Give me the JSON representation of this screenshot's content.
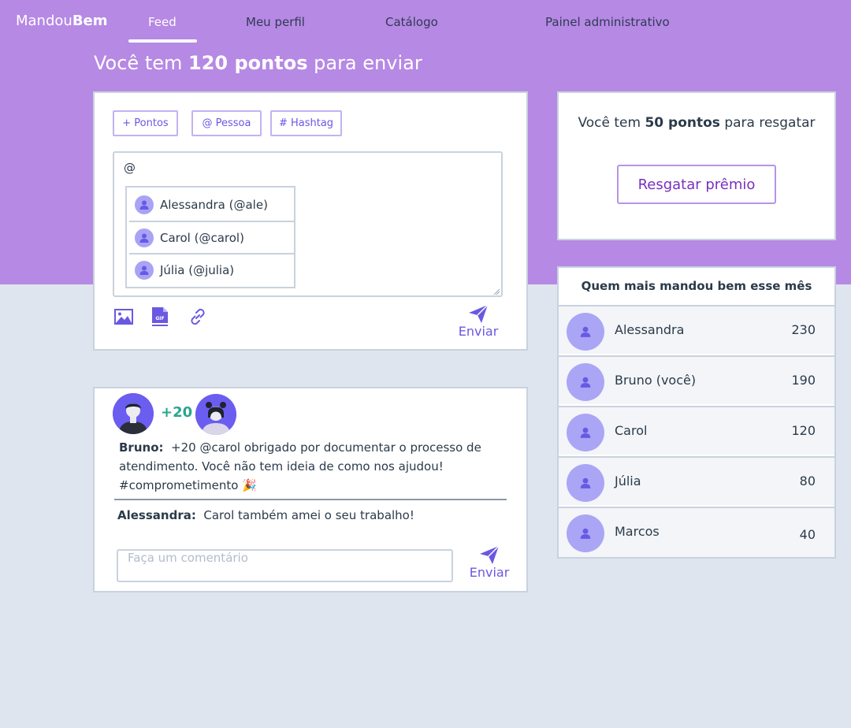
{
  "nav": {
    "logo_regular": "Mandou",
    "logo_bold": "Bem",
    "tabs": [
      {
        "label": "Feed",
        "active": true
      },
      {
        "label": "Meu perfil",
        "active": false
      },
      {
        "label": "Catálogo",
        "active": false
      },
      {
        "label": "Painel administrativo",
        "active": false
      }
    ]
  },
  "header": {
    "prefix": "Você tem",
    "points": "120 pontos",
    "suffix": "para enviar"
  },
  "compose": {
    "chips": [
      "+ Pontos",
      "@ Pessoa",
      "# Hashtag"
    ],
    "text": "@",
    "mentions": [
      "Alessandra (@ale)",
      "Carol (@carol)",
      "Júlia (@julia)"
    ],
    "tools": [
      "image-icon",
      "gif-file-icon",
      "link-icon"
    ],
    "send_label": "Enviar"
  },
  "redeem": {
    "prefix": "Você tem",
    "points": "50 pontos",
    "suffix": "para resgatar",
    "button": "Resgatar prêmio"
  },
  "ranking": {
    "title": "Quem mais mandou bem esse mês",
    "rows": [
      {
        "name": "Alessandra",
        "points": "230"
      },
      {
        "name": "Bruno (você)",
        "points": "190"
      },
      {
        "name": "Carol",
        "points": "120"
      },
      {
        "name": "Júlia",
        "points": "80"
      },
      {
        "name": "Marcos",
        "points": "40"
      }
    ]
  },
  "post": {
    "points": "+20",
    "author": "Bruno:",
    "text": "+20 @carol obrigado por documentar o processo de atendimento. Você não tem ideia de como nos ajudou! #comprometimento 🎉",
    "comments": [
      {
        "author": "Alessandra:",
        "text": "Carol também amei o seu trabalho!"
      }
    ],
    "comment_placeholder": "Faça um comentário",
    "send_label": "Enviar"
  },
  "colors": {
    "purple_band": "#b689e4",
    "accent": "#6a58e3",
    "points_green": "#2aa58e",
    "redeem_text": "#7a2fc0",
    "background": "#dfe5ee"
  }
}
